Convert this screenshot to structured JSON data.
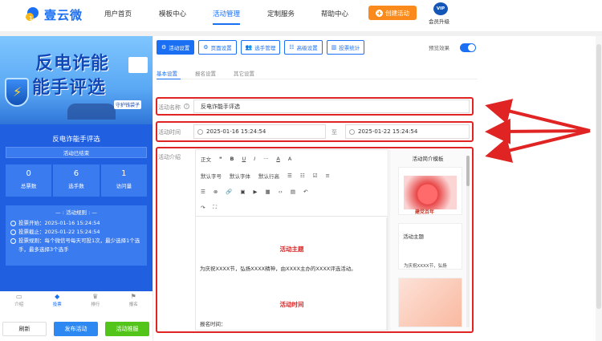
{
  "brand": {
    "name": "壹云微",
    "logo_icon": "cloud-logo-icon"
  },
  "nav": {
    "items": [
      {
        "label": "用户首页"
      },
      {
        "label": "模板中心"
      },
      {
        "label": "活动管理"
      },
      {
        "label": "定制服务"
      },
      {
        "label": "帮助中心"
      }
    ],
    "active": "活动管理",
    "create_button": "创建活动",
    "vip_badge": "VIP",
    "vip_label": "会员升级"
  },
  "preview": {
    "banner_line1": "反电诈能",
    "banner_line2": "能手评选",
    "banner_tag": "守护钱袋子",
    "activity_title": "反电诈能手评选",
    "status": "活动已结束",
    "stats": [
      {
        "value": "0",
        "label": "总票数"
      },
      {
        "value": "6",
        "label": "选手数"
      },
      {
        "value": "1",
        "label": "访问量"
      }
    ],
    "rules_heading": "活动规则",
    "rules": [
      "投票开始：2025-01-16 15:24:54",
      "投票截止：2025-01-22 15:24:54",
      "投票规则：每个微信号每天可投1次，最少选择1个选手，最多选择3个选手"
    ],
    "tabs": [
      {
        "label": "介绍",
        "icon": "intro-icon"
      },
      {
        "label": "投票",
        "icon": "vote-icon"
      },
      {
        "label": "排行",
        "icon": "rank-icon"
      },
      {
        "label": "报名",
        "icon": "signup-icon"
      }
    ],
    "active_tab": "投票"
  },
  "actions": {
    "refresh": "刷新",
    "publish": "发布活动",
    "deploy": "活动推服"
  },
  "toolbar": [
    {
      "label": "活动设置",
      "icon": "settings-icon",
      "active": true
    },
    {
      "label": "页面设置",
      "icon": "gear-icon",
      "active": false
    },
    {
      "label": "选手管理",
      "icon": "users-icon",
      "active": false
    },
    {
      "label": "高级设置",
      "icon": "sliders-icon",
      "active": false
    },
    {
      "label": "投票统计",
      "icon": "bar-chart-icon",
      "active": false
    }
  ],
  "preview_toggle": {
    "label": "预览效果",
    "on": true
  },
  "subtabs": [
    "基本设置",
    "报名设置",
    "其它设置"
  ],
  "form": {
    "name_label": "活动名称",
    "name_value": "反电诈能手评选",
    "time_label": "活动时间",
    "time_start": "2025-01-16 15:24:54",
    "time_sep": "至",
    "time_end": "2025-01-22 15:24:54",
    "intro_label": "活动介绍"
  },
  "editor": {
    "toolbar1": [
      "正文",
      "❝",
      "B",
      "U",
      "I",
      "···",
      "A",
      "A"
    ],
    "toolbar2": [
      "默认字号",
      "默认字体",
      "默认行高",
      "☰",
      "☷",
      "☑",
      "≡"
    ],
    "toolbar3": [
      "☰",
      "⊗",
      "🔗",
      "▣",
      "▶",
      "▦",
      "‹›",
      "▤",
      "↶"
    ],
    "toolbar4": [
      "↷",
      "⛶"
    ],
    "heading1": "活动主题",
    "body1": "为庆祝XXXX节，弘扬XXXX精神，由XXXX主办的XXXX评选活动。",
    "heading2": "活动时间",
    "registration": "报名时间："
  },
  "templates": {
    "title": "活动简介模板",
    "card1_caption": "建党百年",
    "card2_title": "活动主题",
    "card2_sub": "为庆祝XXXX节，弘扬"
  }
}
